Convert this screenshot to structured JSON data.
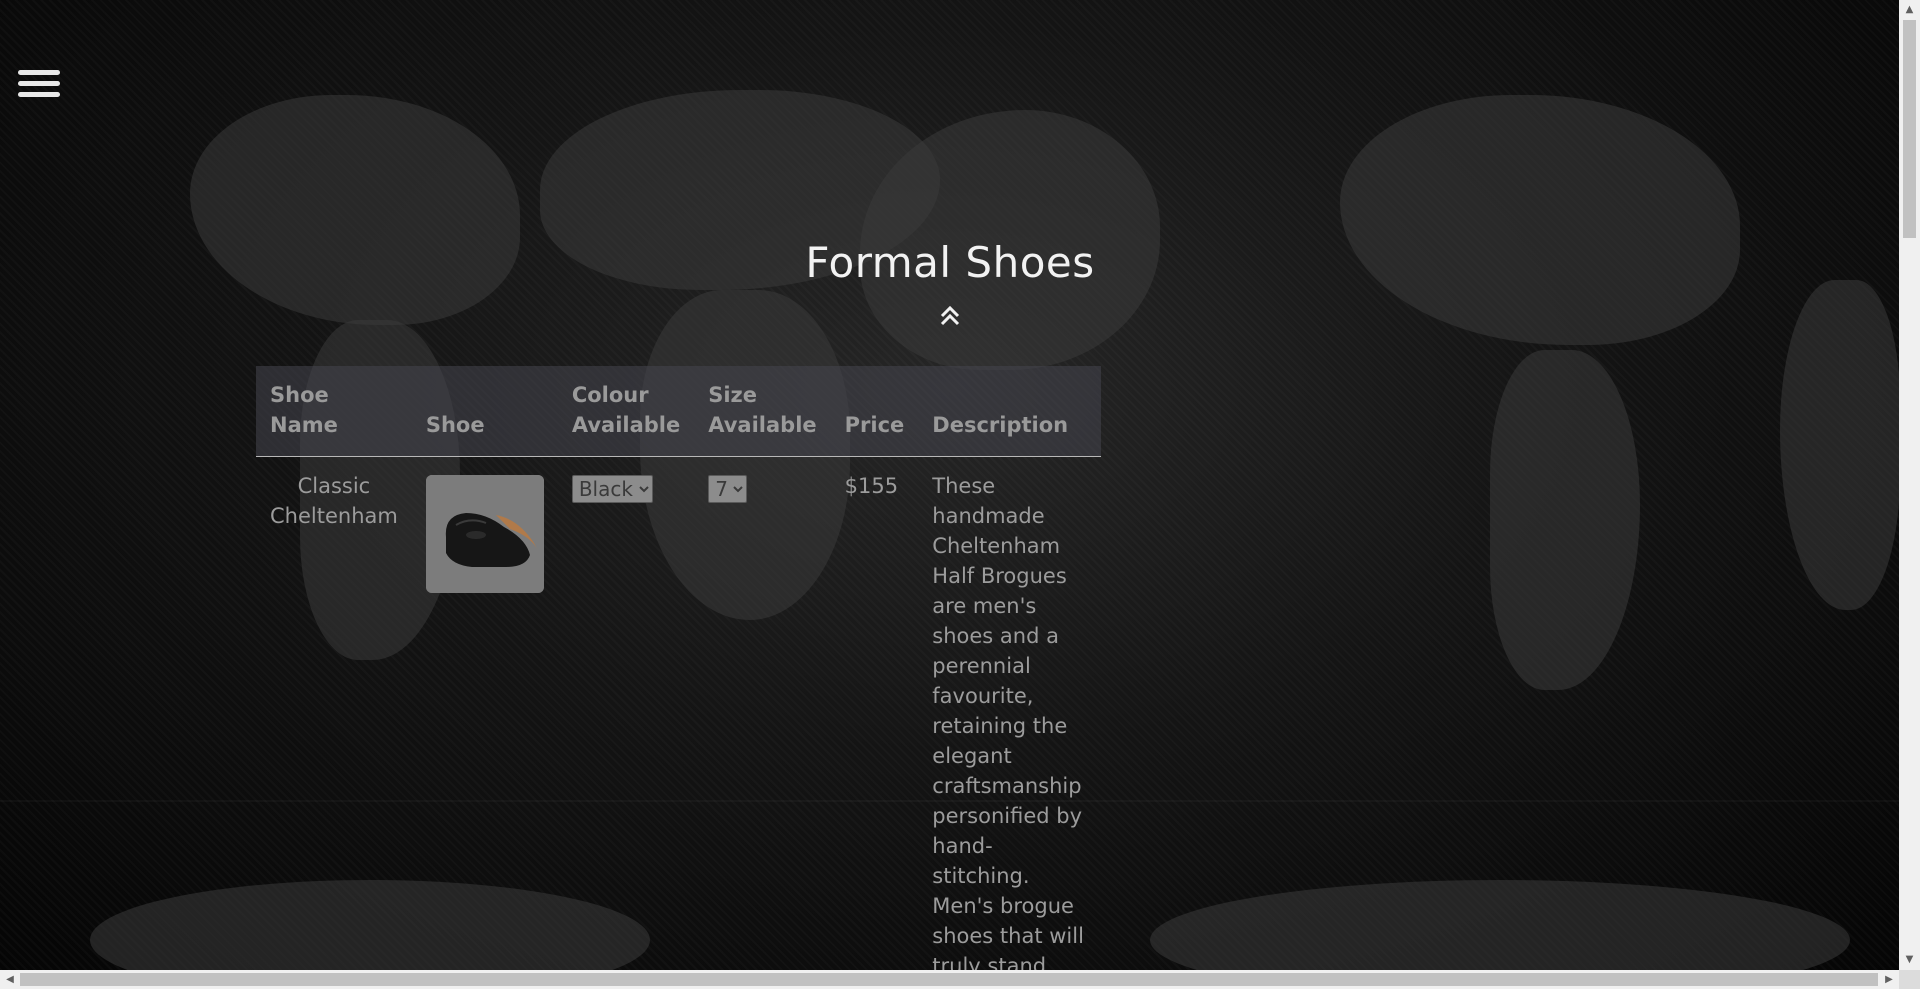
{
  "page": {
    "title": "Formal Shoes",
    "menu_icon": "hamburger-icon",
    "collapse_icon": "double-chevron-up-icon"
  },
  "table": {
    "headers": [
      "Shoe Name",
      "Shoe",
      "Colour Available",
      "Size Available",
      "Price",
      "Description"
    ],
    "rows": [
      {
        "name": "Classic Cheltenham",
        "image_alt": "black-oxford-shoe",
        "colour": "Black",
        "size": "7",
        "price": "$155",
        "description": "These handmade Cheltenham Half Brogues are men's shoes and a perennial favourite, retaining the elegant craftsmanship personified by hand-stitching. Men's brogue shoes that will truly stand"
      }
    ]
  },
  "colors": {
    "background": "#0a0a0a",
    "header_row": "#46464e",
    "text": "#9c9c9c",
    "title": "#f2f2f2"
  }
}
